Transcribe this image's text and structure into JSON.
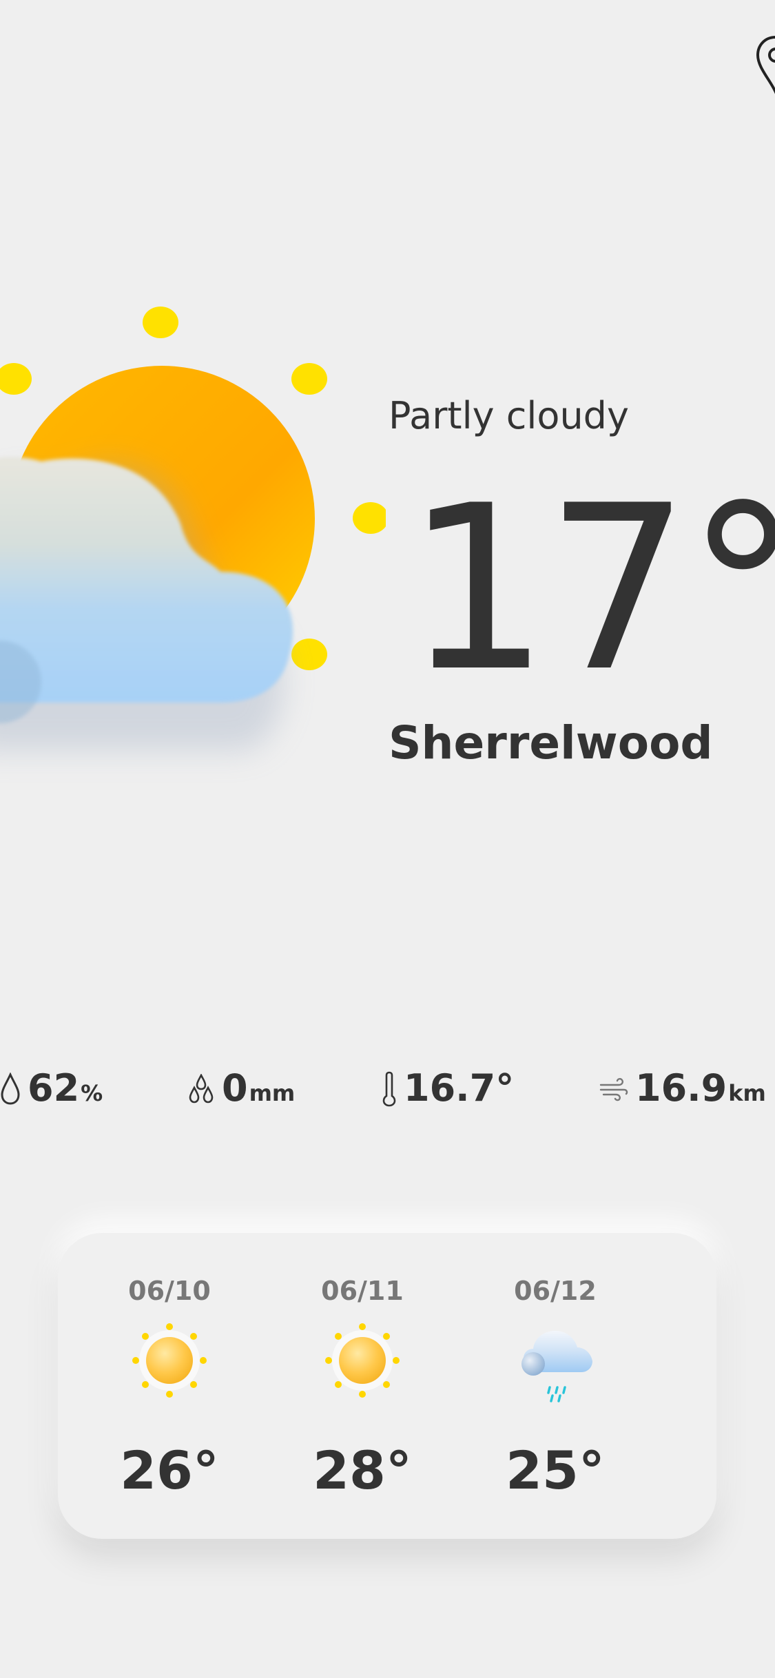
{
  "current": {
    "condition": "Partly cloudy",
    "temperature": "17°",
    "city": "Sherrelwood",
    "icon": "partly-cloudy-icon"
  },
  "header": {
    "location_icon": "location-pin-icon"
  },
  "stats": {
    "humidity": {
      "icon": "droplet-icon",
      "value": "62",
      "unit": "%"
    },
    "precipitation": {
      "icon": "droplets-icon",
      "value": "0",
      "unit": "mm"
    },
    "feels_like": {
      "icon": "thermometer-icon",
      "value": "16.7°"
    },
    "wind": {
      "icon": "wind-icon",
      "value": "16.9",
      "unit": "km"
    }
  },
  "forecast": [
    {
      "date": "06/10",
      "icon": "sunny-icon",
      "temp": "26°"
    },
    {
      "date": "06/11",
      "icon": "sunny-icon",
      "temp": "28°"
    },
    {
      "date": "06/12",
      "icon": "rain-cloud-icon",
      "temp": "25°"
    }
  ],
  "colors": {
    "background": "#efefef",
    "text": "#333333",
    "muted": "#777777",
    "sun": "#ffb300",
    "sun_rays": "#ffe100",
    "cloud": "#a9d3f5",
    "rain": "#29c4d9"
  }
}
